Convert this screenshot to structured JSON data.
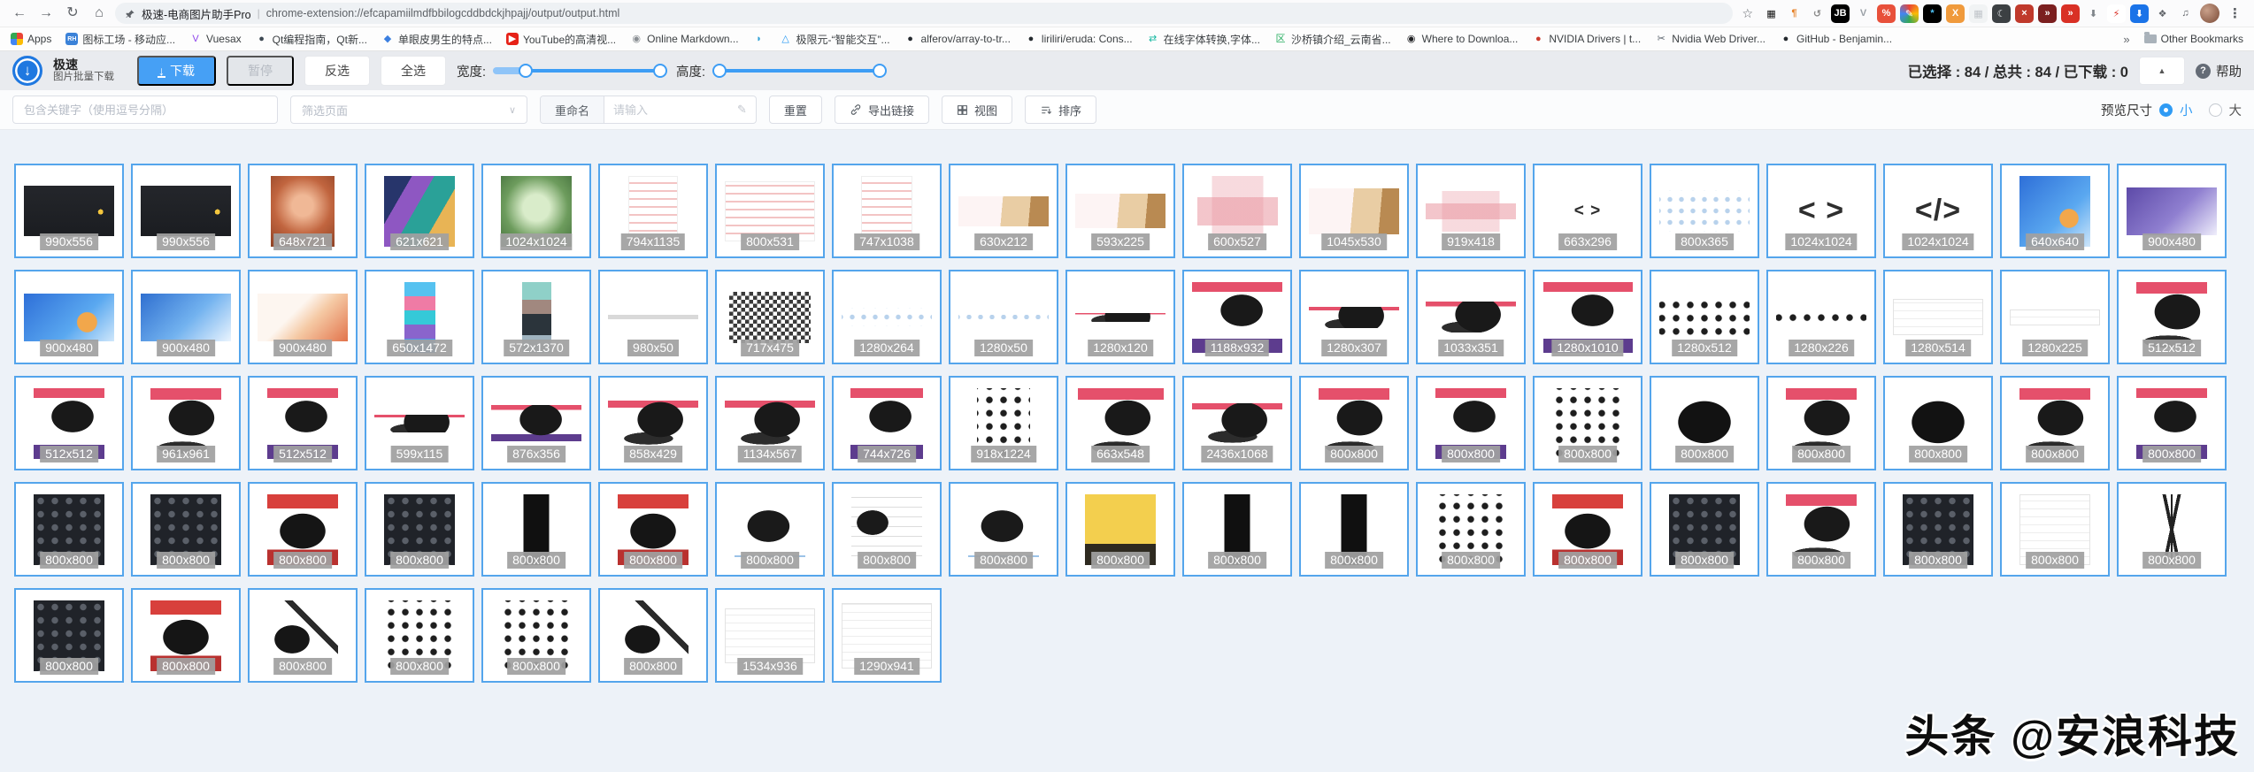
{
  "browser": {
    "nav": {
      "page_title": "极速-电商图片助手Pro",
      "separator": "|",
      "url": "chrome-extension://efcapamiilmdfbbilogcddbdckjhpajj/output/output.html",
      "icons": {
        "back": "←",
        "forward": "→",
        "reload": "↻",
        "home": "⌂",
        "star": "☆",
        "kebab": "⋮"
      }
    },
    "extensions": [
      {
        "name": "qr-code-icon",
        "glyph": "▦",
        "fg": "#111",
        "bg": ""
      },
      {
        "name": "pilcrow-icon",
        "glyph": "¶",
        "fg": "#e67e22",
        "bg": ""
      },
      {
        "name": "history-icon",
        "glyph": "↺",
        "fg": "#8a8a8a",
        "bg": ""
      },
      {
        "name": "jetbrains-icon",
        "glyph": "JB",
        "fg": "#fff",
        "bg": "#000"
      },
      {
        "name": "vuetify-icon",
        "glyph": "V",
        "fg": "#9aa0a6",
        "bg": ""
      },
      {
        "name": "discount-icon",
        "glyph": "%",
        "fg": "#fff",
        "bg": "#e8503a"
      },
      {
        "name": "docs-pencil-icon",
        "glyph": "✎",
        "fg": "#fff",
        "bg": "conic-gradient(#ea4335,#fbbc05,#34a853,#4285f4,#ea4335)"
      },
      {
        "name": "asterisk-icon",
        "glyph": "*",
        "fg": "#4fc3f7",
        "bg": "#000"
      },
      {
        "name": "x-orange-icon",
        "glyph": "X",
        "fg": "#fff",
        "bg": "#f09a3c"
      },
      {
        "name": "grid-icon",
        "glyph": "▦",
        "fg": "#c0c4c9",
        "bg": "#f1f3f4"
      },
      {
        "name": "dark-mode-moon-icon",
        "glyph": "☾",
        "fg": "#e8eaed",
        "bg": "#3c4043"
      },
      {
        "name": "shield-x-icon",
        "glyph": "×",
        "fg": "#fff",
        "bg": "#c0392b"
      },
      {
        "name": "double-arrow-badge-icon",
        "glyph": "»",
        "fg": "#fff",
        "bg": "#7b1f1f"
      },
      {
        "name": "double-arrow-circle-icon",
        "glyph": "»",
        "fg": "#fff",
        "bg": "#d93025"
      },
      {
        "name": "download-arrow-icon",
        "glyph": "⬇",
        "fg": "#80868b",
        "bg": ""
      },
      {
        "name": "lightning-icon",
        "glyph": "⚡",
        "fg": "#d93025",
        "bg": "#fff"
      },
      {
        "name": "blue-download-icon",
        "glyph": "⬇",
        "fg": "#fff",
        "bg": "#1a73e8"
      },
      {
        "name": "extensions-puzzle-icon",
        "glyph": "❖",
        "fg": "#5f6368",
        "bg": ""
      },
      {
        "name": "playlist-icon",
        "glyph": "♫",
        "fg": "#5f6368",
        "bg": ""
      }
    ],
    "bookmarks": {
      "items": [
        {
          "name": "bookmark-apps",
          "label": "Apps",
          "glyph": "",
          "fg": "#fff",
          "bg": "conic-gradient(#ea4335 0 25%,#fbbc05 0 50%,#4285f4 0 75%,#34a853 0)"
        },
        {
          "name": "bookmark-tubiaogongchang",
          "label": "图标工场 - 移动应...",
          "glyph": "RH",
          "fg": "#fff",
          "bg": "#3b82d8"
        },
        {
          "name": "bookmark-vuesax",
          "label": "Vuesax",
          "glyph": "V",
          "fg": "#8e44ec",
          "bg": ""
        },
        {
          "name": "bookmark-qt-guide",
          "label": "Qt编程指南，Qt新...",
          "glyph": "●",
          "fg": "#3d4852",
          "bg": ""
        },
        {
          "name": "bookmark-danyanpi",
          "label": "单眼皮男生的特点...",
          "glyph": "◆",
          "fg": "#3b7fe0",
          "bg": ""
        },
        {
          "name": "bookmark-youtube",
          "label": "YouTube的高清视...",
          "glyph": "▶",
          "fg": "#fff",
          "bg": "#e62117"
        },
        {
          "name": "bookmark-online-markdown",
          "label": "Online Markdown...",
          "glyph": "◉",
          "fg": "#8a8f94",
          "bg": ""
        },
        {
          "name": "bookmark-blue-icon",
          "label": "",
          "glyph": "◗",
          "fg": "#35a3d8",
          "bg": ""
        },
        {
          "name": "bookmark-jixianyuan",
          "label": "极限元-“智能交互”...",
          "glyph": "△",
          "fg": "#2196f3",
          "bg": ""
        },
        {
          "name": "bookmark-alferov",
          "label": "alferov/array-to-tr...",
          "glyph": "●",
          "fg": "#24292e",
          "bg": ""
        },
        {
          "name": "bookmark-eruda",
          "label": "liriliri/eruda: Cons...",
          "glyph": "●",
          "fg": "#24292e",
          "bg": ""
        },
        {
          "name": "bookmark-font-convert",
          "label": "在线字体转换,字体...",
          "glyph": "⇄",
          "fg": "#12b7a0",
          "bg": ""
        },
        {
          "name": "bookmark-shaqiaozhen",
          "label": "沙桥镇介绍_云南省...",
          "glyph": "区",
          "fg": "#27ae60",
          "bg": ""
        },
        {
          "name": "bookmark-where-download",
          "label": "Where to Downloa...",
          "glyph": "◉",
          "fg": "#202124",
          "bg": ""
        },
        {
          "name": "bookmark-nvidia-drivers",
          "label": "NVIDIA Drivers | t...",
          "glyph": "●",
          "fg": "#cd3b2e",
          "bg": ""
        },
        {
          "name": "bookmark-nvidia-web-driver",
          "label": "Nvidia Web Driver...",
          "glyph": "✂",
          "fg": "#57606a",
          "bg": ""
        },
        {
          "name": "bookmark-github-benjamin",
          "label": "GitHub - Benjamin...",
          "glyph": "●",
          "fg": "#24292e",
          "bg": ""
        }
      ],
      "overflow": "»",
      "other_bookmarks": "Other Bookmarks"
    }
  },
  "toolbar": {
    "logo_title": "极速",
    "logo_subtitle": "图片批量下载",
    "logo_glyph": "↓",
    "download_icon": "↓",
    "download_label": "下载",
    "pause_label": "暂停",
    "invert_label": "反选",
    "select_all_label": "全选",
    "width_label": "宽度:",
    "height_label": "高度:",
    "stats_text": "已选择 : 84 / 总共 : 84 / 已下载 : 0",
    "collapse_glyph": "▲",
    "help_icon": "?",
    "help_label": "帮助"
  },
  "filterbar": {
    "keyword_placeholder": "包含关键字（使用逗号分隔）",
    "page_filter_placeholder": "筛选页面",
    "chevron": "∨",
    "rename_label": "重命名",
    "rename_placeholder": "请输入",
    "pencil_glyph": "✎",
    "reset_label": "重置",
    "export_label": "导出链接",
    "view_label": "视图",
    "sort_label": "排序",
    "preview_size_label": "预览尺寸",
    "small_label": "小",
    "large_label": "大"
  },
  "colors": {
    "accent": "#3d9df5",
    "selected_border": "#54a5ec",
    "dim_label_bg": "#a0a0a0"
  },
  "grid": {
    "rows": [
      [
        {
          "l": "990x556",
          "k": "dark-slide"
        },
        {
          "l": "990x556",
          "k": "dark-slide"
        },
        {
          "l": "648x721",
          "k": "photo-orange"
        },
        {
          "l": "621x621",
          "k": "photo-colorful"
        },
        {
          "l": "1024x1024",
          "k": "photo-green"
        },
        {
          "l": "794x1135",
          "k": "doc-red"
        },
        {
          "l": "800x531",
          "k": "doc-red"
        },
        {
          "l": "747x1038",
          "k": "doc-red"
        },
        {
          "l": "630x212",
          "k": "cake"
        },
        {
          "l": "593x225",
          "k": "cake"
        },
        {
          "l": "600x527",
          "k": "diagram-red"
        },
        {
          "l": "1045x530",
          "k": "cake"
        },
        {
          "l": "919x418",
          "k": "diagram-red"
        },
        {
          "l": "663x296",
          "k": "glyph",
          "g": "< >"
        },
        {
          "l": "800x365",
          "k": "tree"
        },
        {
          "l": "1024x1024",
          "k": "glyph",
          "g": "< >"
        },
        {
          "l": "1024x1024",
          "k": "glyph",
          "g": "</>"
        },
        {
          "l": "640x640",
          "k": "promo-blue"
        },
        {
          "l": "900x480",
          "k": "illus-purple"
        }
      ],
      [
        {
          "l": "900x480",
          "k": "promo-blue"
        },
        {
          "l": "900x480",
          "k": "illus-blue"
        },
        {
          "l": "900x480",
          "k": "illus-orange"
        },
        {
          "l": "650x1472",
          "k": "strip-vert"
        },
        {
          "l": "572x1370",
          "k": "strip-vert2"
        },
        {
          "l": "980x50",
          "k": "text-line"
        },
        {
          "l": "717x475",
          "k": "qr"
        },
        {
          "l": "1280x264",
          "k": "tree"
        },
        {
          "l": "1280x50",
          "k": "tree"
        },
        {
          "l": "1280x120",
          "k": "camera-promo"
        },
        {
          "l": "1188x932",
          "k": "camera-purple"
        },
        {
          "l": "1280x307",
          "k": "camera-promo"
        },
        {
          "l": "1033x351",
          "k": "camera-promo"
        },
        {
          "l": "1280x1010",
          "k": "camera-purple"
        },
        {
          "l": "1280x512",
          "k": "accessories"
        },
        {
          "l": "1280x226",
          "k": "accessories"
        },
        {
          "l": "1280x514",
          "k": "white-page"
        },
        {
          "l": "1280x225",
          "k": "white-page"
        },
        {
          "l": "512x512",
          "k": "camera-promo"
        }
      ],
      [
        {
          "l": "512x512",
          "k": "camera-purple"
        },
        {
          "l": "961x961",
          "k": "camera-promo"
        },
        {
          "l": "512x512",
          "k": "camera-purple"
        },
        {
          "l": "599x115",
          "k": "camera-promo"
        },
        {
          "l": "876x356",
          "k": "camera-purple"
        },
        {
          "l": "858x429",
          "k": "camera-promo"
        },
        {
          "l": "1134x567",
          "k": "camera-promo"
        },
        {
          "l": "744x726",
          "k": "camera-purple"
        },
        {
          "l": "918x1224",
          "k": "accessories"
        },
        {
          "l": "663x548",
          "k": "camera-promo"
        },
        {
          "l": "2436x1068",
          "k": "camera-promo"
        },
        {
          "l": "800x800",
          "k": "camera-promo"
        },
        {
          "l": "800x800",
          "k": "camera-purple"
        },
        {
          "l": "800x800",
          "k": "accessories"
        },
        {
          "l": "800x800",
          "k": "camera-dark"
        },
        {
          "l": "800x800",
          "k": "camera-promo"
        },
        {
          "l": "800x800",
          "k": "camera-dark"
        },
        {
          "l": "800x800",
          "k": "camera-promo"
        },
        {
          "l": "800x800",
          "k": "camera-purple"
        }
      ],
      [
        {
          "l": "800x800",
          "k": "accessories-dark"
        },
        {
          "l": "800x800",
          "k": "accessories-dark"
        },
        {
          "l": "800x800",
          "k": "camera-red"
        },
        {
          "l": "800x800",
          "k": "accessories-dark"
        },
        {
          "l": "800x800",
          "k": "lens"
        },
        {
          "l": "800x800",
          "k": "camera-red"
        },
        {
          "l": "800x800",
          "k": "camera-white"
        },
        {
          "l": "800x800",
          "k": "camera-diagram"
        },
        {
          "l": "800x800",
          "k": "camera-white"
        },
        {
          "l": "800x800",
          "k": "film-yellow"
        },
        {
          "l": "800x800",
          "k": "lens"
        },
        {
          "l": "800x800",
          "k": "lens"
        },
        {
          "l": "800x800",
          "k": "accessories"
        },
        {
          "l": "800x800",
          "k": "camera-red"
        },
        {
          "l": "800x800",
          "k": "accessories-dark"
        },
        {
          "l": "800x800",
          "k": "camera-promo"
        },
        {
          "l": "800x800",
          "k": "accessories-dark"
        },
        {
          "l": "800x800",
          "k": "white-page"
        },
        {
          "l": "800x800",
          "k": "tripod"
        }
      ],
      [
        {
          "l": "800x800",
          "k": "accessories-dark"
        },
        {
          "l": "800x800",
          "k": "camera-red"
        },
        {
          "l": "800x800",
          "k": "camera-mic"
        },
        {
          "l": "800x800",
          "k": "accessories"
        },
        {
          "l": "800x800",
          "k": "accessories"
        },
        {
          "l": "800x800",
          "k": "camera-mic"
        },
        {
          "l": "1534x936",
          "k": "white-page"
        },
        {
          "l": "1290x941",
          "k": "white-page"
        }
      ]
    ]
  },
  "watermark": "头条 @安浪科技"
}
